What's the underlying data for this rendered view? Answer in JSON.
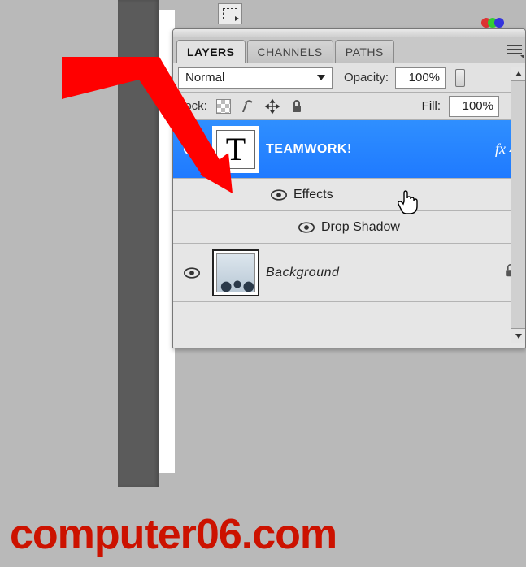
{
  "tabs": {
    "layers": "LAYERS",
    "channels": "CHANNELS",
    "paths": "PATHS"
  },
  "blend_mode": "Normal",
  "opacity": {
    "label": "Opacity:",
    "value": "100%"
  },
  "lock": {
    "label": "Lock:"
  },
  "fill": {
    "label": "Fill:",
    "value": "100%"
  },
  "layers": {
    "text": {
      "thumb_glyph": "T",
      "name": "TEAMWORK!",
      "fx_label": "fx"
    },
    "effects_label": "Effects",
    "drop_shadow_label": "Drop Shadow",
    "background": {
      "name": "Background"
    }
  },
  "watermark": "computer06.com"
}
